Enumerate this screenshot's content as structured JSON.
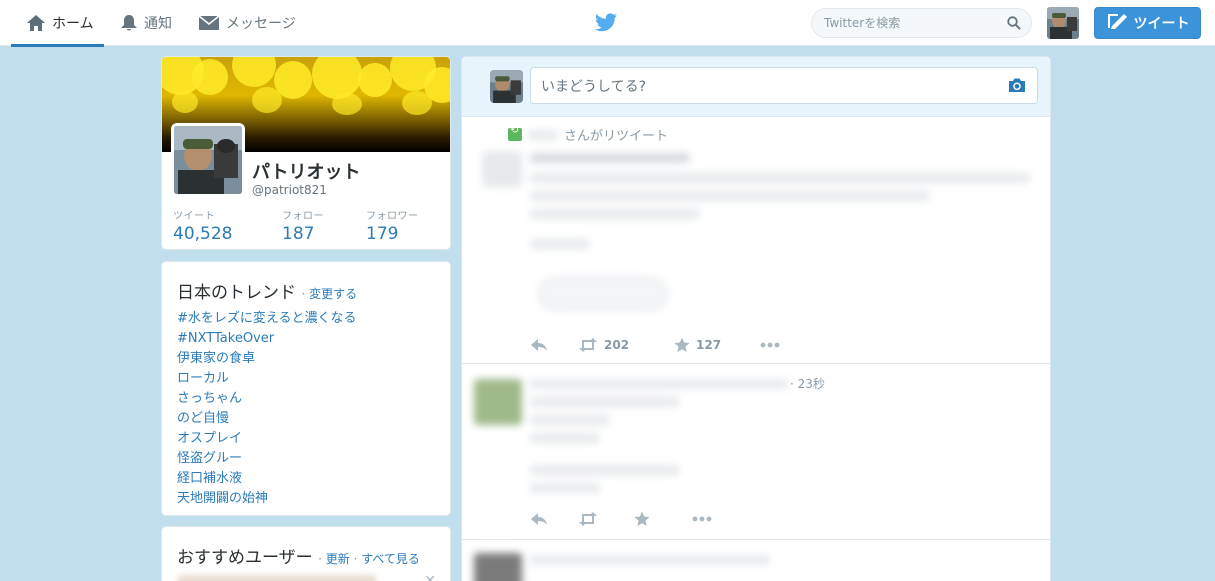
{
  "nav": {
    "home_label": "ホーム",
    "notifications_label": "通知",
    "messages_label": "メッセージ"
  },
  "search": {
    "placeholder": "Twitterを検索"
  },
  "tweet_button": {
    "label": "ツイート"
  },
  "profile": {
    "name": "パトリオット",
    "handle": "@patriot821",
    "stats": [
      {
        "label": "ツイート",
        "value": "40,528"
      },
      {
        "label": "フォロー",
        "value": "187"
      },
      {
        "label": "フォロワー",
        "value": "179"
      }
    ]
  },
  "trends": {
    "title": "日本のトレンド",
    "separator": "·",
    "change_label": "変更する",
    "items": [
      "#水をレズに変えると濃くなる",
      "#NXTTakeOver",
      "伊東家の食卓",
      "ローカル",
      "さっちゃん",
      "のど自慢",
      "オスプレイ",
      "怪盗グルー",
      "経口補水液",
      "天地開闢の始神"
    ]
  },
  "who_to_follow": {
    "title": "おすすめユーザー",
    "separator": "·",
    "refresh_label": "更新",
    "separator2": "·",
    "view_all_label": "すべて見る"
  },
  "composer": {
    "placeholder": "いまどうしてる?"
  },
  "timeline": {
    "tweet1": {
      "retweet_suffix": "さんがリツイート",
      "retweet_count": "202",
      "favorite_count": "127"
    },
    "tweet2": {
      "time": "· 23秒"
    }
  },
  "colors": {
    "brand": "#55acee",
    "link": "#2b7bb9",
    "tweet_button": "#3b94d9",
    "background": "#c0deed"
  }
}
